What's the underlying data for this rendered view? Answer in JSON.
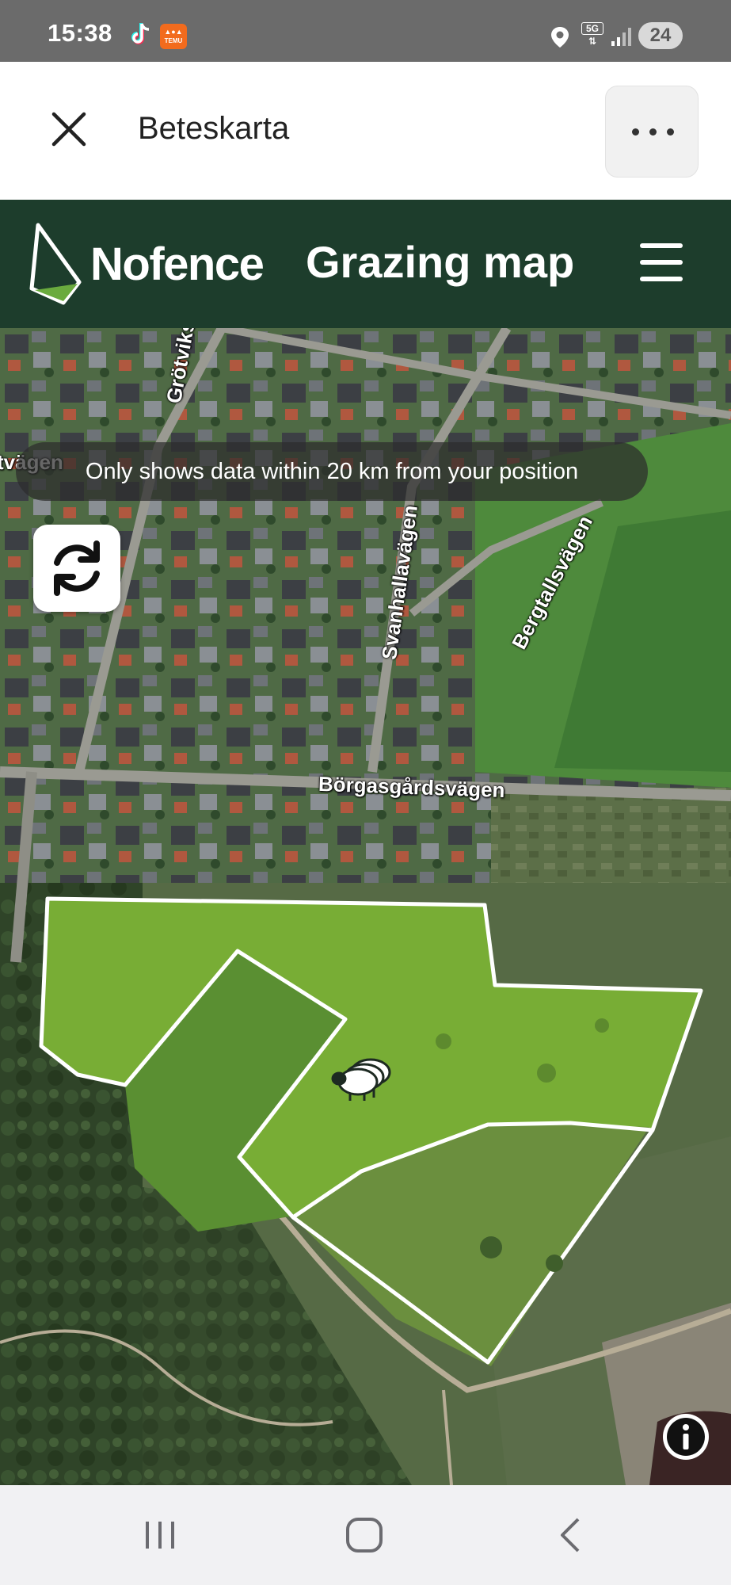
{
  "status_bar": {
    "time": "15:38",
    "temu_label": "TEMU",
    "network_label": "5G",
    "battery": "24",
    "icons": [
      "tiktok-icon",
      "temu-icon",
      "location-icon",
      "signal-icon"
    ]
  },
  "app_header": {
    "title": "Beteskarta",
    "icons": [
      "close-icon",
      "more-icon"
    ]
  },
  "nofence_bar": {
    "brand": "Nofence",
    "title": "Grazing map",
    "background_color": "#1d3d2c",
    "logo_accent_color": "#6aab3e",
    "icons": [
      "nofence-logo-icon",
      "hamburger-menu-icon"
    ]
  },
  "map": {
    "info_banner": "Only shows data within 20 km from your position",
    "street_labels": {
      "grotviks": "Grötviks",
      "tvagen": "tvägen",
      "svanhallavagen": "Svanhallavägen",
      "bergtallsvagen": "Bergtallsvägen",
      "borgasgardsvagen": "Börgasgårdsvägen"
    },
    "icons": [
      "refresh-icon",
      "sheep-herd-icon",
      "info-icon"
    ],
    "fence_color": "#ffffff",
    "pasture_color": "#7fb23a"
  },
  "nav_bar": {
    "icons": [
      "recent-apps-icon",
      "home-icon",
      "back-icon"
    ]
  }
}
